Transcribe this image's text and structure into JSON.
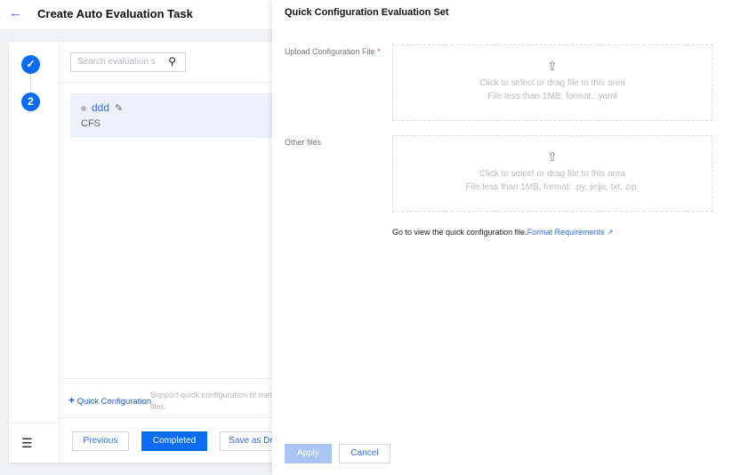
{
  "header": {
    "title": "Create Auto Evaluation Task"
  },
  "steps": [
    {
      "state": "done"
    },
    {
      "label": "2"
    }
  ],
  "search": {
    "placeholder": "Search evaluation s"
  },
  "items": [
    {
      "name": "ddd",
      "subtitle": "CFS"
    }
  ],
  "quick_config": {
    "label": "Quick Configuration",
    "description": "Support quick configuration of metr files."
  },
  "footer": {
    "previous": "Previous",
    "completed": "Completed",
    "save_draft": "Save as Dr"
  },
  "drawer": {
    "title": "Quick Configuration Evaluation Set",
    "upload_config": {
      "label": "Upload Configuration File",
      "required": "*",
      "line1": "Click to select or drag file to this area",
      "line2": "File less than 1MB, format: .yaml"
    },
    "other_files": {
      "label": "Other files",
      "line1": "Click to select or drag file to this area",
      "line2": "File less than 1MB, format: .py, jinja, txt, zip."
    },
    "hint": "Go to view the quick configuration file.",
    "hint_link": "Format Requirements",
    "apply": "Apply",
    "cancel": "Cancel"
  },
  "colors": {
    "primary": "#0a6cf5"
  }
}
